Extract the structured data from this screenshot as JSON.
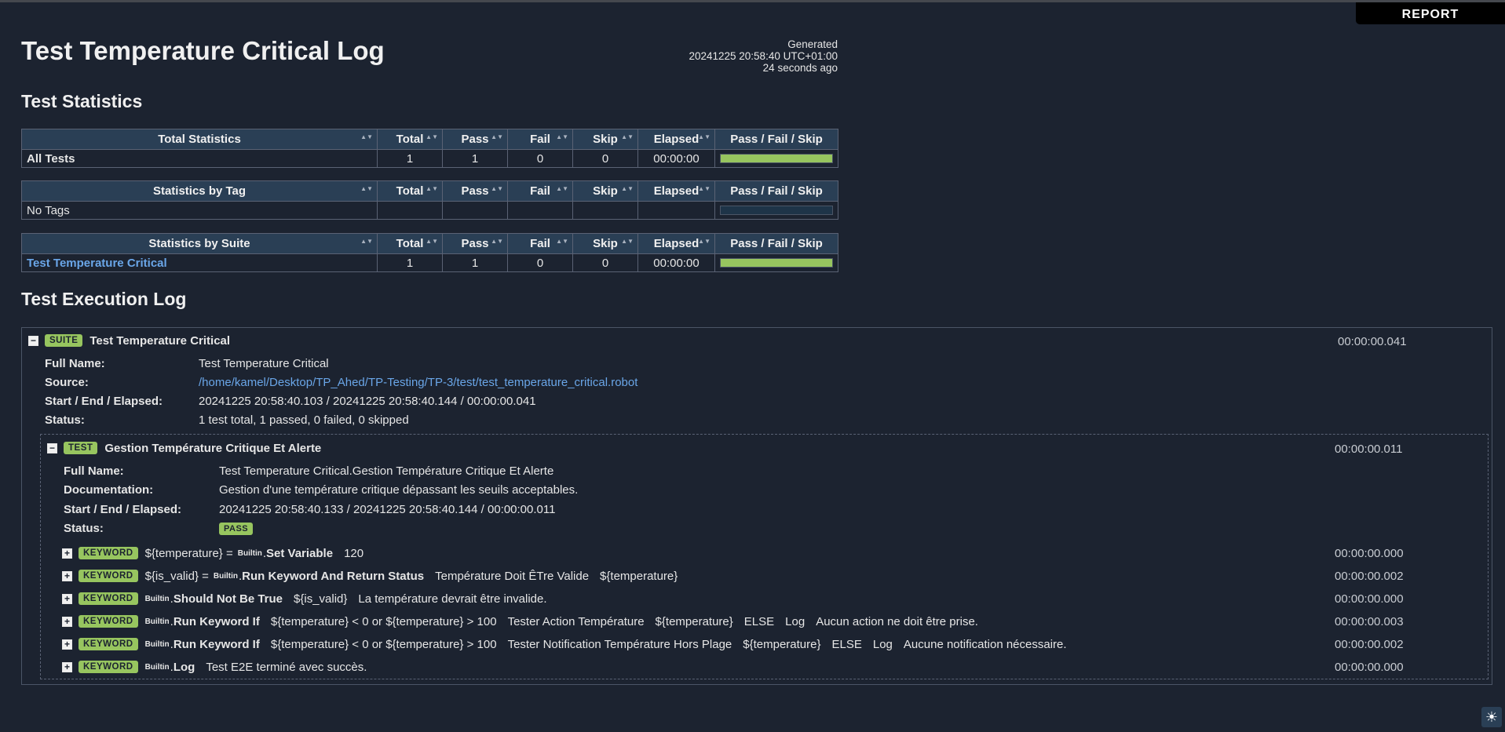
{
  "report_link": "REPORT",
  "header": {
    "title": "Test Temperature Critical Log",
    "generated_label": "Generated",
    "generated_time": "20241225 20:58:40 UTC+01:00",
    "generated_ago": "24 seconds ago"
  },
  "sections": {
    "statistics": "Test Statistics",
    "execution_log": "Test Execution Log"
  },
  "stat_columns": [
    "Total",
    "Pass",
    "Fail",
    "Skip",
    "Elapsed",
    "Pass / Fail / Skip"
  ],
  "total_stats": {
    "header": "Total Statistics",
    "row": {
      "name": "All Tests",
      "total": "1",
      "pass": "1",
      "fail": "0",
      "skip": "0",
      "elapsed": "00:00:00",
      "pass_fraction": 1.0
    }
  },
  "tag_stats": {
    "header": "Statistics by Tag",
    "row": {
      "name": "No Tags",
      "pass_fraction": 0.0
    }
  },
  "suite_stats": {
    "header": "Statistics by Suite",
    "row": {
      "name": "Test Temperature Critical",
      "total": "1",
      "pass": "1",
      "fail": "0",
      "skip": "0",
      "elapsed": "00:00:00",
      "pass_fraction": 1.0
    }
  },
  "suite": {
    "badge": "SUITE",
    "name": "Test Temperature Critical",
    "elapsed": "00:00:00.041",
    "full_name_label": "Full Name:",
    "full_name": "Test Temperature Critical",
    "source_label": "Source:",
    "source": "/home/kamel/Desktop/TP_Ahed/TP-Testing/TP-3/test/test_temperature_critical.robot",
    "times_label": "Start / End / Elapsed:",
    "times": "20241225 20:58:40.103 / 20241225 20:58:40.144 / 00:00:00.041",
    "status_label": "Status:",
    "status": "1 test total, 1 passed, 0 failed, 0 skipped"
  },
  "test": {
    "badge": "TEST",
    "name": "Gestion Température Critique Et Alerte",
    "elapsed": "00:00:00.011",
    "full_name_label": "Full Name:",
    "full_name": "Test Temperature Critical.Gestion Température Critique Et Alerte",
    "doc_label": "Documentation:",
    "doc": "Gestion d'une température critique dépassant les seuils acceptables.",
    "times_label": "Start / End / Elapsed:",
    "times": "20241225 20:58:40.133 / 20241225 20:58:40.144 / 00:00:00.011",
    "status_label": "Status:",
    "status": "PASS"
  },
  "keyword_badge": "KEYWORD",
  "library": "Builtin",
  "keywords": [
    {
      "assign": "${temperature} =",
      "name": "Set Variable",
      "args": [
        "120"
      ],
      "elapsed": "00:00:00.000"
    },
    {
      "assign": "${is_valid} =",
      "name": "Run Keyword And Return Status",
      "args": [
        "Température Doit ÊTre Valide",
        "${temperature}"
      ],
      "elapsed": "00:00:00.002"
    },
    {
      "assign": "",
      "name": "Should Not Be True",
      "args": [
        "${is_valid}",
        "La température devrait être invalide."
      ],
      "elapsed": "00:00:00.000"
    },
    {
      "assign": "",
      "name": "Run Keyword If",
      "args": [
        "${temperature} < 0 or ${temperature} > 100",
        "Tester Action Température",
        "${temperature}",
        "ELSE",
        "Log",
        "Aucun action ne doit être prise."
      ],
      "elapsed": "00:00:00.003"
    },
    {
      "assign": "",
      "name": "Run Keyword If",
      "args": [
        "${temperature} < 0 or ${temperature} > 100",
        "Tester Notification Température Hors Plage",
        "${temperature}",
        "ELSE",
        "Log",
        "Aucune notification nécessaire."
      ],
      "elapsed": "00:00:00.002"
    },
    {
      "assign": "",
      "name": "Log",
      "args": [
        "Test E2E terminé avec succès."
      ],
      "elapsed": "00:00:00.000"
    }
  ]
}
